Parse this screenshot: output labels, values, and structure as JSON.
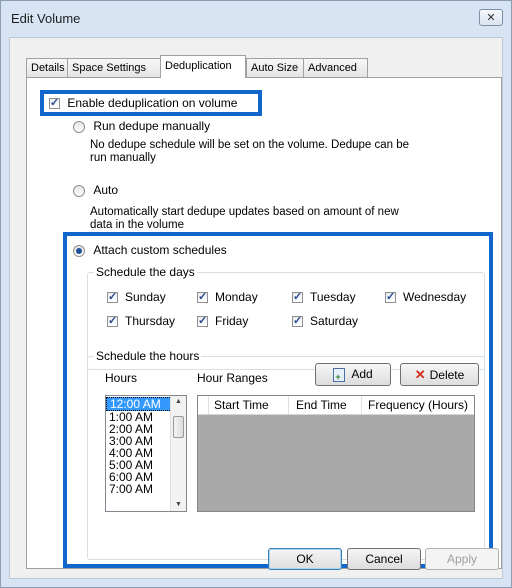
{
  "window": {
    "title": "Edit Volume",
    "close_glyph": "✕"
  },
  "tabs": [
    {
      "label": "Details"
    },
    {
      "label": "Space Settings"
    },
    {
      "label": "Deduplication"
    },
    {
      "label": "Auto Size"
    },
    {
      "label": "Advanced"
    }
  ],
  "dedup": {
    "enable_label": "Enable deduplication on volume",
    "enable_checked": true,
    "run_manual_label": "Run dedupe manually",
    "run_manual_desc": "No dedupe schedule will be set on the volume. Dedupe can be run manually",
    "auto_label": "Auto",
    "auto_desc": "Automatically start dedupe updates based on amount of new data in the volume",
    "custom_label": "Attach custom schedules",
    "selected_mode": "custom"
  },
  "days": {
    "title": "Schedule the days",
    "items": [
      {
        "label": "Sunday",
        "checked": true
      },
      {
        "label": "Monday",
        "checked": true
      },
      {
        "label": "Tuesday",
        "checked": true
      },
      {
        "label": "Wednesday",
        "checked": true
      },
      {
        "label": "Thursday",
        "checked": true
      },
      {
        "label": "Friday",
        "checked": true
      },
      {
        "label": "Saturday",
        "checked": true
      }
    ]
  },
  "hours": {
    "title": "Schedule the hours",
    "hours_label": "Hours",
    "ranges_label": "Hour Ranges",
    "add_label": "Add",
    "delete_label": "Delete",
    "add_icon": "add-document-icon",
    "delete_icon": "red-x-icon",
    "list": [
      "12:00 AM",
      "1:00 AM",
      "2:00 AM",
      "3:00 AM",
      "4:00 AM",
      "5:00 AM",
      "6:00 AM",
      "7:00 AM"
    ],
    "selected": "12:00 AM",
    "columns": [
      "Start Time",
      "End Time",
      "Frequency (Hours)"
    ]
  },
  "footer": {
    "ok": "OK",
    "cancel": "Cancel",
    "apply": "Apply"
  },
  "colors": {
    "highlight": "#1166cc",
    "selection": "#3399ff",
    "delete_icon": "#d62b1e"
  }
}
